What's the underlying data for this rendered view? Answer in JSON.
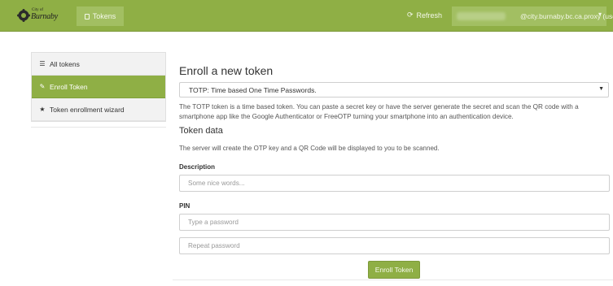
{
  "topbar": {
    "logo_small": "City of",
    "logo_name": "Burnaby",
    "tokens_label": "Tokens",
    "refresh_label": "Refresh",
    "user_label": "@city.burnaby.bc.ca.proxy (user)",
    "caret": "▾",
    "color": "#8faf45"
  },
  "sidebar": {
    "items": [
      {
        "label": "All tokens",
        "icon": "☰",
        "icon_name": "list-icon"
      },
      {
        "label": "Enroll Token",
        "icon": "✎",
        "icon_name": "edit-icon"
      },
      {
        "label": "Token enrollment wizard",
        "icon": "★",
        "icon_name": "star-icon"
      }
    ]
  },
  "main": {
    "title": "Enroll a new token",
    "select_value": "TOTP: Time based One Time Passwords.",
    "description": "The TOTP token is a time based token. You can paste a secret key or have the server generate the secret and scan the QR code with a smartphone app like the Google Authenticator or FreeOTP turning your smartphone into an authentication device.",
    "token_data_title": "Token data",
    "token_data_info": "The server will create the OTP key and a QR Code will be displayed to you to be scanned.",
    "description_label": "Description",
    "description_placeholder": "Some nice words...",
    "pin_label": "PIN",
    "pin_placeholder": "Type a password",
    "pin_repeat_placeholder": "Repeat password",
    "enroll_button": "Enroll Token"
  }
}
